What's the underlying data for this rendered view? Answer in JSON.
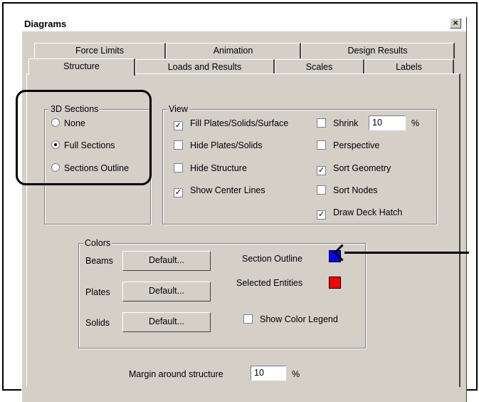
{
  "dialog": {
    "title": "Diagrams",
    "close_glyph": "×"
  },
  "tabs": {
    "row_back": [
      "Force Limits",
      "Animation",
      "Design Results"
    ],
    "row_front": [
      "Structure",
      "Loads and Results",
      "Scales",
      "Labels"
    ],
    "active": "Structure"
  },
  "sections_3d": {
    "title": "3D Sections",
    "options": [
      {
        "label": "None",
        "selected": false
      },
      {
        "label": "Full Sections",
        "selected": true
      },
      {
        "label": "Sections Outline",
        "selected": false
      }
    ]
  },
  "view": {
    "title": "View",
    "left": [
      {
        "label": "Fill Plates/Solids/Surface",
        "checked": true
      },
      {
        "label": "Hide Plates/Solids",
        "checked": false
      },
      {
        "label": "Hide Structure",
        "checked": false
      },
      {
        "label": "Show Center Lines",
        "checked": true
      }
    ],
    "right": [
      {
        "label": "Shrink",
        "checked": false
      },
      {
        "label": "Perspective",
        "checked": false
      },
      {
        "label": "Sort Geometry",
        "checked": true
      },
      {
        "label": "Sort Nodes",
        "checked": false
      },
      {
        "label": "Draw Deck Hatch",
        "checked": true
      }
    ],
    "shrink_value": "10",
    "shrink_unit": "%"
  },
  "colors": {
    "title": "Colors",
    "rows": [
      {
        "label": "Beams",
        "button": "Default..."
      },
      {
        "label": "Plates",
        "button": "Default..."
      },
      {
        "label": "Solids",
        "button": "Default..."
      }
    ],
    "section_outline_label": "Section Outline",
    "section_outline_color": "#0000ff",
    "selected_entities_label": "Selected Entities",
    "selected_entities_color": "#ff0000",
    "show_legend_label": "Show Color Legend",
    "show_legend_checked": false
  },
  "margin": {
    "label": "Margin around structure",
    "value": "10",
    "unit": "%"
  }
}
